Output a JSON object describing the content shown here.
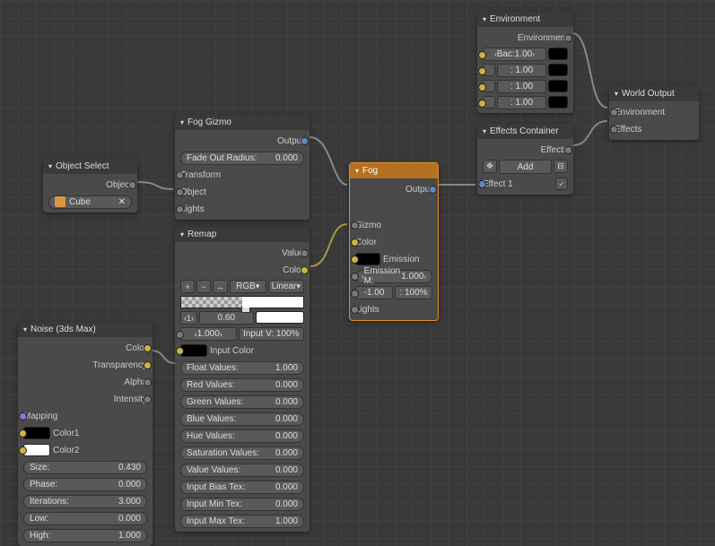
{
  "nodes": {
    "object_select": {
      "title": "Object Select",
      "out_object": "Object",
      "field": "Cube"
    },
    "noise": {
      "title": "Noise (3ds Max)",
      "outputs": [
        "Color",
        "Transparency",
        "Alpha",
        "Intensity"
      ],
      "mapping": "Mapping",
      "color1": "Color1",
      "color2": "Color2",
      "params": [
        {
          "l": "Size:",
          "v": "0.430"
        },
        {
          "l": "Phase:",
          "v": "0.000"
        },
        {
          "l": "Iterations:",
          "v": "3.000"
        },
        {
          "l": "Low:",
          "v": "0.000"
        },
        {
          "l": "High:",
          "v": "1.000"
        }
      ]
    },
    "fog_gizmo": {
      "title": "Fog Gizmo",
      "output": "Output",
      "fade": {
        "l": "Fade Out Radius:",
        "v": "0.000"
      },
      "transform": "Transform",
      "object": "Object",
      "lights": "Lights"
    },
    "remap": {
      "title": "Remap",
      "out_value": "Value",
      "out_color": "Color",
      "mode1": "RGB",
      "mode2": "Linear",
      "pos": "0.60",
      "inv": {
        "l": "1.000",
        "r": "Input V: 100%"
      },
      "input_color": "Input Color",
      "params": [
        {
          "l": "Float Values:",
          "v": "1.000"
        },
        {
          "l": "Red Values:",
          "v": "0.000"
        },
        {
          "l": "Green Values:",
          "v": "0.000"
        },
        {
          "l": "Blue Values:",
          "v": "0.000"
        },
        {
          "l": "Hue Values:",
          "v": "0.000"
        },
        {
          "l": "Saturation Values:",
          "v": "0.000"
        },
        {
          "l": "Value Values:",
          "v": "0.000"
        },
        {
          "l": "Input Bias Tex:",
          "v": "0.000"
        },
        {
          "l": "Input Min Tex:",
          "v": "0.000"
        },
        {
          "l": "Input Max Tex:",
          "v": "1.000"
        }
      ]
    },
    "fog": {
      "title": "Fog",
      "output": "Output",
      "gizmo": "Gizmo",
      "color": "Color",
      "emission": "Emission",
      "em": {
        "l": "Emission M:",
        "v": "1.000"
      },
      "dist": {
        "l": "-1.00",
        "r": ": 100%"
      },
      "lights": "Lights"
    },
    "env": {
      "title": "Environment",
      "sub": "Environment",
      "bac": {
        "l": "Bac:",
        "v": "1.00"
      },
      "rows": [
        {
          "l": ": 1.00"
        },
        {
          "l": ": 1.00"
        },
        {
          "l": ": 1.00"
        }
      ]
    },
    "effects": {
      "title": "Effects Container",
      "out": "Effects",
      "add": "Add",
      "eff1": "Effect 1"
    },
    "world": {
      "title": "World Output",
      "env": "Environment",
      "eff": "Effects"
    }
  }
}
